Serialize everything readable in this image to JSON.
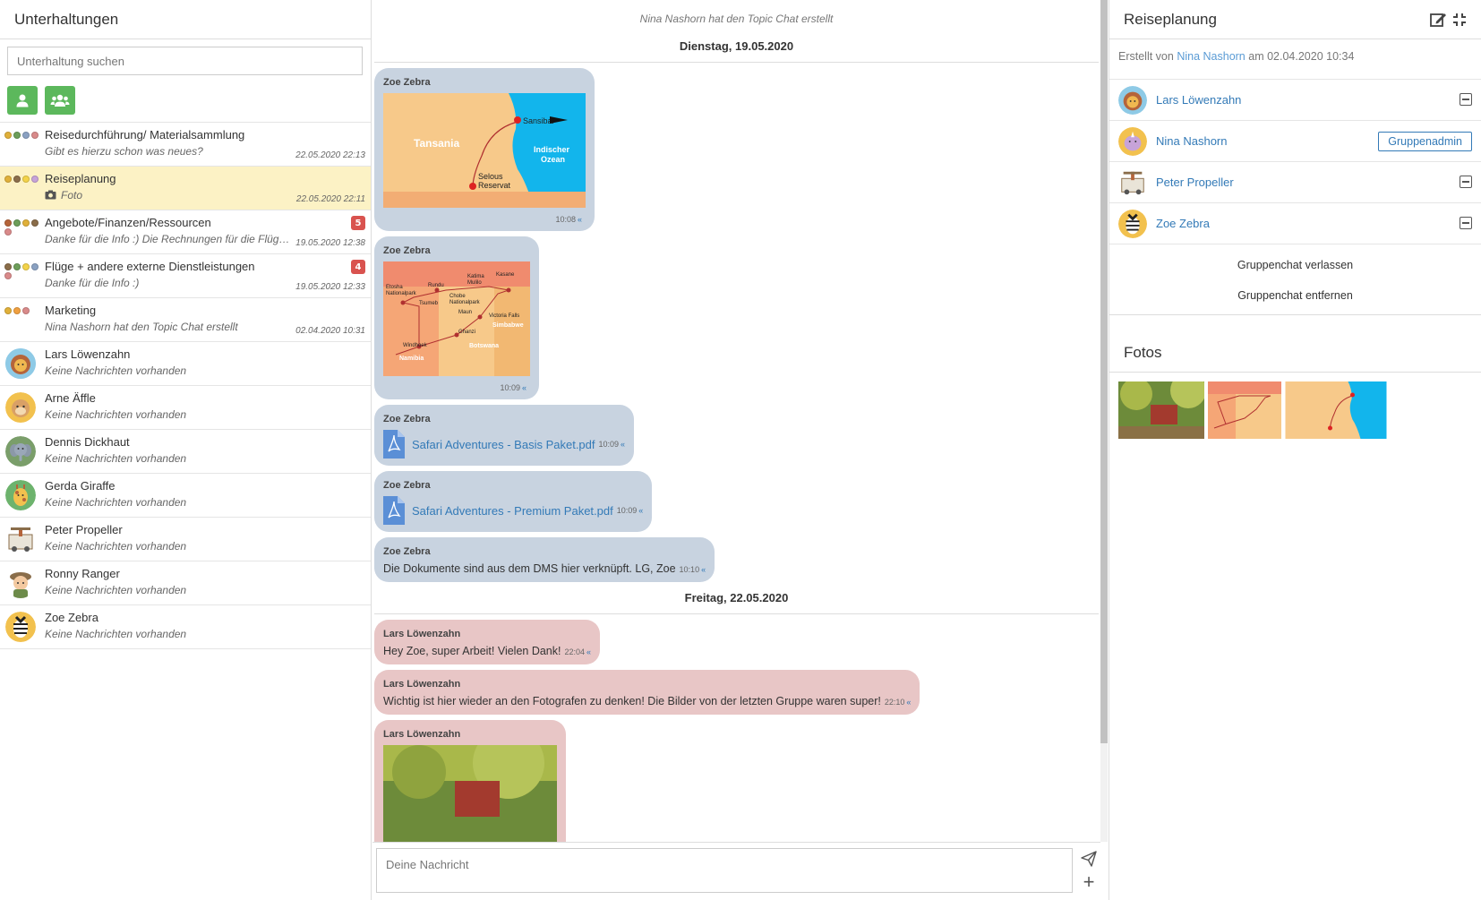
{
  "sidebar": {
    "title": "Unterhaltungen",
    "search_placeholder": "Unterhaltung suchen",
    "conversations": [
      {
        "name": "Reisedurchführung/ Materialsammlung",
        "preview": "Gibt es hierzu schon was neues?",
        "time": "22.05.2020 22:13",
        "badge": ""
      },
      {
        "name": "Reiseplanung",
        "preview": "Foto",
        "time": "22.05.2020 22:11",
        "badge": ""
      },
      {
        "name": "Angebote/Finanzen/Ressourcen",
        "preview": "Danke für die Info :) Die Rechnungen für die Flüge wurden bezahlt",
        "time": "19.05.2020 12:38",
        "badge": "5"
      },
      {
        "name": "Flüge + andere externe Dienstleistungen",
        "preview": "Danke für die Info :)",
        "time": "19.05.2020 12:33",
        "badge": "4"
      },
      {
        "name": "Marketing",
        "preview": "Nina Nashorn hat den Topic Chat erstellt",
        "time": "02.04.2020 10:31",
        "badge": ""
      },
      {
        "name": "Lars Löwenzahn",
        "preview": "Keine Nachrichten vorhanden",
        "time": "",
        "badge": ""
      },
      {
        "name": "Arne Äffle",
        "preview": "Keine Nachrichten vorhanden",
        "time": "",
        "badge": ""
      },
      {
        "name": "Dennis Dickhaut",
        "preview": "Keine Nachrichten vorhanden",
        "time": "",
        "badge": ""
      },
      {
        "name": "Gerda Giraffe",
        "preview": "Keine Nachrichten vorhanden",
        "time": "",
        "badge": ""
      },
      {
        "name": "Peter Propeller",
        "preview": "Keine Nachrichten vorhanden",
        "time": "",
        "badge": ""
      },
      {
        "name": "Ronny Ranger",
        "preview": "Keine Nachrichten vorhanden",
        "time": "",
        "badge": ""
      },
      {
        "name": "Zoe Zebra",
        "preview": "Keine Nachrichten vorhanden",
        "time": "",
        "badge": ""
      }
    ]
  },
  "chat": {
    "system_message": "Nina Nashorn hat den Topic Chat erstellt",
    "day1": "Dienstag, 19.05.2020",
    "day2": "Freitag, 22.05.2020",
    "messages": [
      {
        "author": "Zoe Zebra",
        "time": "10:08"
      },
      {
        "author": "Zoe Zebra",
        "time": "10:09"
      },
      {
        "author": "Zoe Zebra",
        "file": "Safari Adventures - Basis Paket.pdf",
        "time": "10:09"
      },
      {
        "author": "Zoe Zebra",
        "file": "Safari Adventures - Premium Paket.pdf",
        "time": "10:09"
      },
      {
        "author": "Zoe Zebra",
        "text": "Die Dokumente sind aus dem DMS hier verknüpft. LG, Zoe",
        "time": "10:10"
      },
      {
        "author": "Lars Löwenzahn",
        "text": "Hey Zoe, super Arbeit! Vielen Dank!",
        "time": "22:04"
      },
      {
        "author": "Lars Löwenzahn",
        "text": "Wichtig ist hier wieder an den Fotografen zu denken! Die Bilder von der letzten Gruppe waren super!",
        "time": "22:10"
      },
      {
        "author": "Lars Löwenzahn",
        "time": ""
      }
    ],
    "map1": {
      "country": "Tansania",
      "ocean1": "Indischer",
      "ocean2": "Ozean",
      "city1": "Sansibar",
      "city2a": "Selous",
      "city2b": "Reservat"
    },
    "map2": {
      "etosha1": "Etosha",
      "etosha2": "Nationalpark",
      "rundu": "Rundu",
      "katima1": "Katima",
      "katima2": "Mulilo",
      "kasane": "Kasane",
      "chobe1": "Chobe",
      "chobe2": "Nationalpark",
      "tsumeb": "Tsumeb",
      "maun": "Maun",
      "victoria": "Victoria Falls",
      "simbabwe": "Simbabwe",
      "ghanzi": "Ghanzi",
      "windhoek": "Windhoek",
      "namibia": "Namibia",
      "botswana": "Botswana"
    },
    "composer_placeholder": "Deine Nachricht"
  },
  "info": {
    "title": "Reiseplanung",
    "created_prefix": "Erstellt von",
    "created_by": "Nina Nashorn",
    "created_suffix": "am 02.04.2020 10:34",
    "members": [
      {
        "name": "Lars Löwenzahn"
      },
      {
        "name": "Nina Nashorn",
        "role": "Gruppenadmin"
      },
      {
        "name": "Peter Propeller"
      },
      {
        "name": "Zoe Zebra"
      }
    ],
    "leave_label": "Gruppenchat verlassen",
    "remove_label": "Gruppenchat entfernen",
    "photos_title": "Fotos"
  },
  "colors": {
    "accent": "#337ab7",
    "green": "#5cb85c",
    "active_row": "#fcf2c5",
    "bubble_blue": "#c8d3e0",
    "bubble_pink": "#e8c6c6",
    "badge": "#d9534f"
  }
}
